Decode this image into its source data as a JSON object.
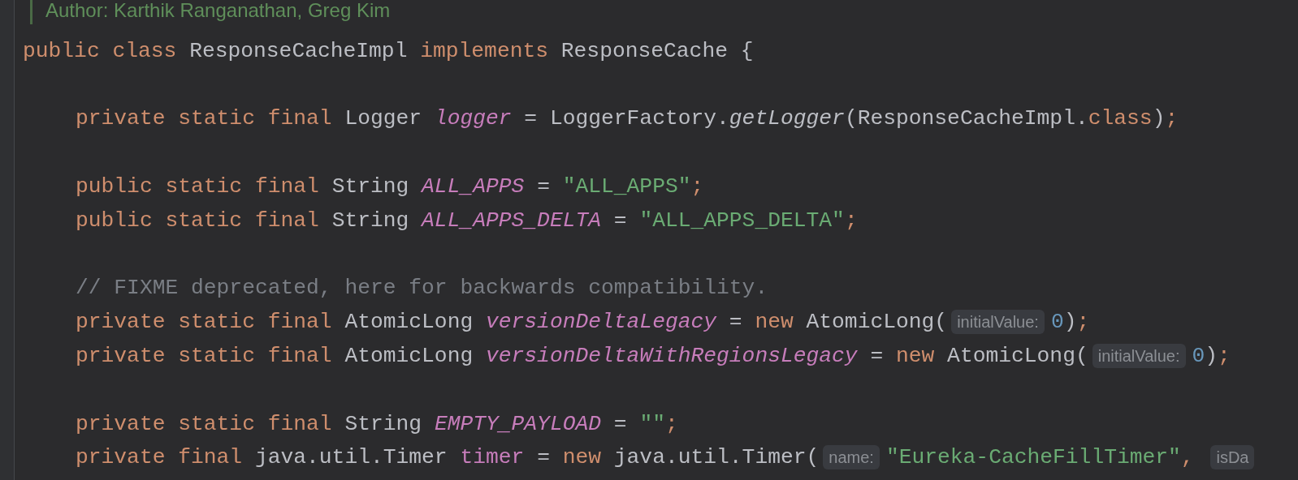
{
  "editor": {
    "lines": [
      {
        "kind": "doc",
        "tokens": [
          {
            "kind": "doc",
            "text": "Author: Karthik Ranganathan, Greg Kim"
          }
        ]
      },
      {
        "kind": "decl",
        "tokens": [
          {
            "kind": "kw",
            "text": "public class "
          },
          {
            "kind": "id",
            "text": "ResponseCacheImpl "
          },
          {
            "kind": "kw",
            "text": "implements "
          },
          {
            "kind": "id",
            "text": "ResponseCache {"
          }
        ]
      },
      {
        "kind": "blank"
      },
      {
        "kind": "member",
        "tokens": [
          {
            "kind": "kw",
            "text": "private static final "
          },
          {
            "kind": "id",
            "text": "Logger "
          },
          {
            "kind": "field_static",
            "text": "logger "
          },
          {
            "kind": "id",
            "text": "= LoggerFactory."
          },
          {
            "kind": "method",
            "text": "getLogger"
          },
          {
            "kind": "id",
            "text": "(ResponseCacheImpl."
          },
          {
            "kind": "kw",
            "text": "class"
          },
          {
            "kind": "id",
            "text": ")"
          },
          {
            "kind": "semi",
            "text": ";"
          }
        ]
      },
      {
        "kind": "blank"
      },
      {
        "kind": "member",
        "tokens": [
          {
            "kind": "kw",
            "text": "public static final "
          },
          {
            "kind": "id",
            "text": "String "
          },
          {
            "kind": "field_static",
            "text": "ALL_APPS "
          },
          {
            "kind": "id",
            "text": "= "
          },
          {
            "kind": "str",
            "text": "\"ALL_APPS\""
          },
          {
            "kind": "semi",
            "text": ";"
          }
        ]
      },
      {
        "kind": "member",
        "tokens": [
          {
            "kind": "kw",
            "text": "public static final "
          },
          {
            "kind": "id",
            "text": "String "
          },
          {
            "kind": "field_static",
            "text": "ALL_APPS_DELTA "
          },
          {
            "kind": "id",
            "text": "= "
          },
          {
            "kind": "str",
            "text": "\"ALL_APPS_DELTA\""
          },
          {
            "kind": "semi",
            "text": ";"
          }
        ]
      },
      {
        "kind": "blank"
      },
      {
        "kind": "member",
        "tokens": [
          {
            "kind": "cmt",
            "text": "// FIXME deprecated, here for backwards compatibility."
          }
        ]
      },
      {
        "kind": "member",
        "tokens": [
          {
            "kind": "kw",
            "text": "private static final "
          },
          {
            "kind": "id",
            "text": "AtomicLong "
          },
          {
            "kind": "field_static",
            "text": "versionDeltaLegacy "
          },
          {
            "kind": "id",
            "text": "= "
          },
          {
            "kind": "kw",
            "text": "new "
          },
          {
            "kind": "id",
            "text": "AtomicLong("
          },
          {
            "kind": "hint",
            "text": "initialValue:"
          },
          {
            "kind": "num",
            "text": "0"
          },
          {
            "kind": "id",
            "text": ")"
          },
          {
            "kind": "semi",
            "text": ";"
          }
        ]
      },
      {
        "kind": "member",
        "tokens": [
          {
            "kind": "kw",
            "text": "private static final "
          },
          {
            "kind": "id",
            "text": "AtomicLong "
          },
          {
            "kind": "field_static",
            "text": "versionDeltaWithRegionsLegacy "
          },
          {
            "kind": "id",
            "text": "= "
          },
          {
            "kind": "kw",
            "text": "new "
          },
          {
            "kind": "id",
            "text": "AtomicLong("
          },
          {
            "kind": "hint",
            "text": "initialValue:"
          },
          {
            "kind": "num",
            "text": "0"
          },
          {
            "kind": "id",
            "text": ")"
          },
          {
            "kind": "semi",
            "text": ";"
          }
        ]
      },
      {
        "kind": "blank"
      },
      {
        "kind": "member",
        "tokens": [
          {
            "kind": "kw",
            "text": "private static final "
          },
          {
            "kind": "id",
            "text": "String "
          },
          {
            "kind": "field_static",
            "text": "EMPTY_PAYLOAD "
          },
          {
            "kind": "id",
            "text": "= "
          },
          {
            "kind": "str",
            "text": "\"\""
          },
          {
            "kind": "semi",
            "text": ";"
          }
        ]
      },
      {
        "kind": "member",
        "tokens": [
          {
            "kind": "kw",
            "text": "private final "
          },
          {
            "kind": "id",
            "text": "java.util.Timer "
          },
          {
            "kind": "field",
            "text": "timer "
          },
          {
            "kind": "id",
            "text": "= "
          },
          {
            "kind": "kw",
            "text": "new "
          },
          {
            "kind": "id",
            "text": "java.util.Timer("
          },
          {
            "kind": "hint",
            "text": "name:"
          },
          {
            "kind": "str",
            "text": "\"Eureka-CacheFillTimer\""
          },
          {
            "kind": "semi",
            "text": ", "
          },
          {
            "kind": "hint",
            "text": "isDa"
          }
        ]
      }
    ]
  }
}
